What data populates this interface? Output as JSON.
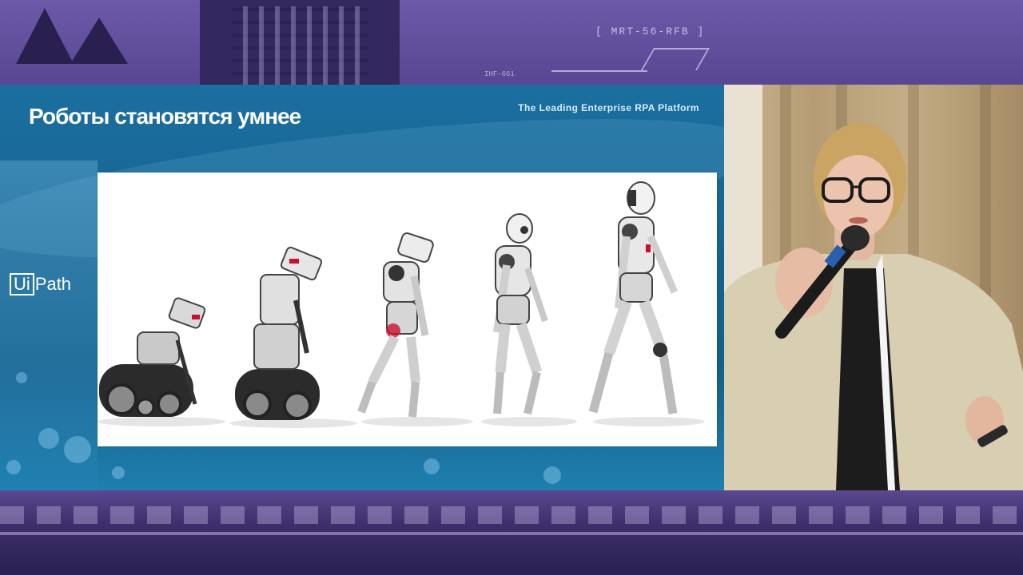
{
  "backdrop": {
    "tech_label": "[ MRT-56-RFB ]",
    "tech_small": "IHF-661"
  },
  "slide": {
    "title": "Роботы становятся умнее",
    "tagline": "The Leading Enterprise RPA Platform",
    "logo_box": "Ui",
    "logo_rest": "Path",
    "image_subject": "robot-evolution-illustration"
  },
  "speaker": {
    "description_icon": "presenter-with-microphone"
  },
  "colors": {
    "slide_blue": "#16638f",
    "backdrop_purple": "#4c3a82",
    "accent_red": "#c8102e"
  }
}
